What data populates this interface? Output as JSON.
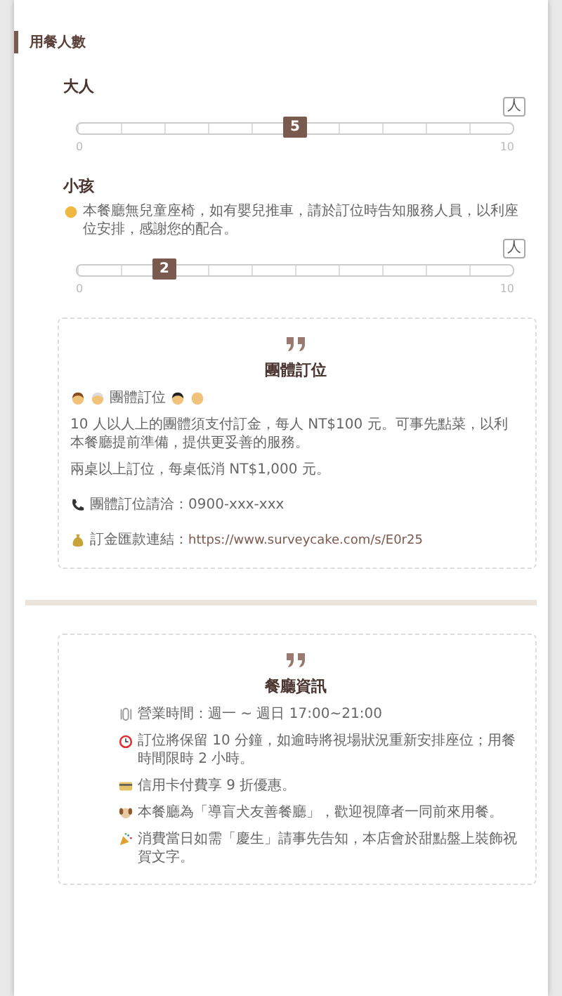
{
  "section": {
    "title": "用餐人數"
  },
  "sliders": [
    {
      "label": "大人",
      "unit": "人",
      "value": "5",
      "level": 0.5,
      "min_label": "0",
      "max_label": "10"
    },
    {
      "label": "小孩",
      "note": "本餐廳無兒童座椅，如有嬰兒推車，請於訂位時告知服務人員，以利座位安排，感謝您的配合。",
      "unit": "人",
      "value": "2",
      "level": 0.2,
      "min_label": "0",
      "max_label": "10"
    }
  ],
  "cards": [
    {
      "title": "團體訂位",
      "lines": [
        {
          "kind": "emoji-title",
          "text": "團體訂位"
        },
        {
          "kind": "plain",
          "text": "10 人以人上的團體須支付訂金，每人 NT$100 元。可事先點菜，以利本餐廳提前準備，提供更妥善的服務。"
        },
        {
          "kind": "plain",
          "text": "兩桌以上訂位，每桌低消 NT$1,000 元。"
        },
        {
          "kind": "icon",
          "text": "團體訂位請洽：0900-xxx-xxx"
        },
        {
          "kind": "icon",
          "text": "訂金匯款連結：",
          "link": "https://www.surveycake.com/s/E0r25"
        }
      ]
    },
    {
      "title": "餐廳資訊",
      "lines": [
        {
          "kind": "icon",
          "text": "營業時間：週一 ~ 週日 17:00~21:00"
        },
        {
          "kind": "icon",
          "text": "訂位將保留 10 分鐘，如逾時將視場狀況重新安排座位；用餐時間限時 2 小時。"
        },
        {
          "kind": "icon",
          "text": "信用卡付費享 9 折優惠。"
        },
        {
          "kind": "icon",
          "text": "本餐廳為「導盲犬友善餐廳」，歡迎視障者一同前來用餐。"
        },
        {
          "kind": "icon",
          "text": "消費當日如需「慶生」請事先告知，本店會於甜點盤上裝飾祝賀文字。"
        }
      ]
    }
  ]
}
